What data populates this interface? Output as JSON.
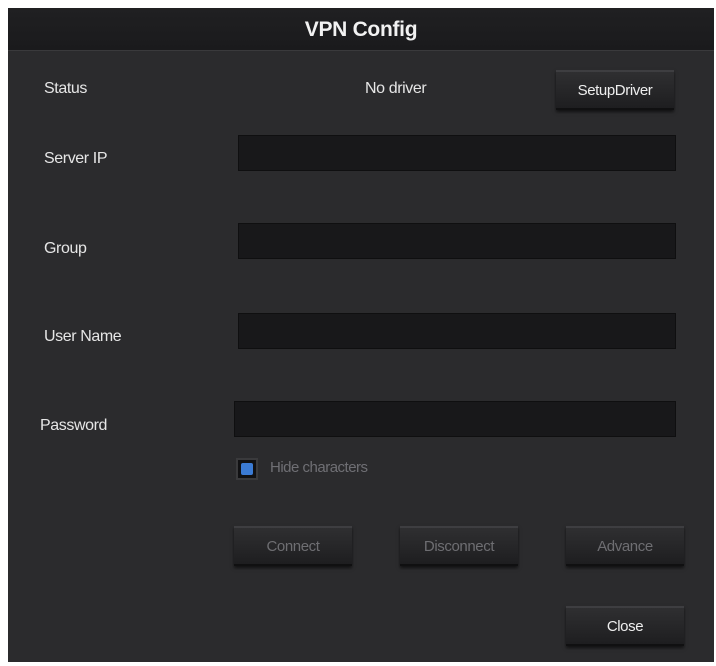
{
  "dialog": {
    "title": "VPN Config"
  },
  "status": {
    "label": "Status",
    "value": "No driver",
    "setup_button": "SetupDriver"
  },
  "fields": {
    "server_ip": {
      "label": "Server IP",
      "value": ""
    },
    "group": {
      "label": "Group",
      "value": ""
    },
    "user_name": {
      "label": "User Name",
      "value": ""
    },
    "password": {
      "label": "Password",
      "value": ""
    }
  },
  "hide_characters": {
    "label": "Hide characters",
    "checked": true
  },
  "actions": {
    "connect": "Connect",
    "disconnect": "Disconnect",
    "advance": "Advance",
    "close": "Close"
  },
  "colors": {
    "dialog_bg": "#2b2b2d",
    "field_bg": "#18181a",
    "checkbox_accent": "#3b7bd4",
    "disabled_text": "#6e6e72"
  }
}
